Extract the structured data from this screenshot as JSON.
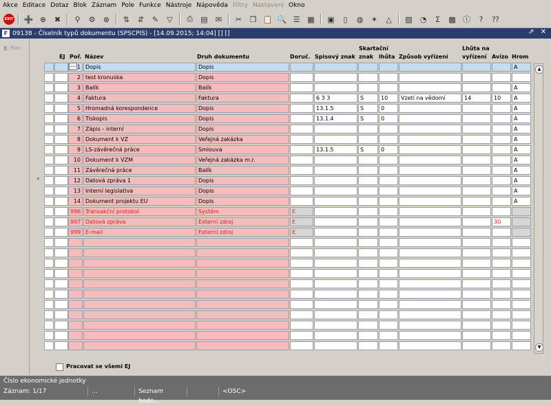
{
  "menu": [
    "Akce",
    "Editace",
    "Dotaz",
    "Blok",
    "Záznam",
    "Pole",
    "Funkce",
    "Nástroje",
    "Nápověda",
    "Filtry",
    "Nastavení",
    "Okno"
  ],
  "menu_disabled": [
    false,
    false,
    false,
    false,
    false,
    false,
    false,
    false,
    false,
    true,
    true,
    false
  ],
  "window": {
    "icon": "F",
    "title": "09138 - Číselník typů dokumentu (SPSCPIS) - [14.09.2015; 14:04]  []  []",
    "controls": "⇗ ✕"
  },
  "leftpane": {
    "nav": "Nav"
  },
  "headers": {
    "ej": "EJ",
    "por": "Poř.",
    "nazev": "Název",
    "druh": "Druh dokumentu",
    "doruc": "Doruč.",
    "spis": "Spisový znak",
    "skart": "Skartační",
    "skart_znak": "znak",
    "skart_lhuta": "lhůta",
    "zpusob": "Způsob vyřízení",
    "lhuta_na": "Lhůta na",
    "lhuta_vyr": "vyřízení",
    "avizo": "Avízo",
    "hrom": "Hrom"
  },
  "rows": [
    {
      "marker": "",
      "ej": "",
      "por": "1",
      "nazev": "Dopis",
      "druh": "Dopis",
      "doruc": "",
      "spis": "",
      "znak": "",
      "lhuta": "",
      "zpusob": "",
      "lvyr": "",
      "avizo": "",
      "hrom": "A",
      "style": "current"
    },
    {
      "marker": "",
      "ej": "",
      "por": "2",
      "nazev": "test kronuska",
      "druh": "Dopis",
      "doruc": "",
      "spis": "",
      "znak": "",
      "lhuta": "",
      "zpusob": "",
      "lvyr": "",
      "avizo": "",
      "hrom": "",
      "style": "normal"
    },
    {
      "marker": "",
      "ej": "",
      "por": "3",
      "nazev": "Balík",
      "druh": "Balík",
      "doruc": "",
      "spis": "",
      "znak": "",
      "lhuta": "",
      "zpusob": "",
      "lvyr": "",
      "avizo": "",
      "hrom": "A",
      "style": "normal"
    },
    {
      "marker": "",
      "ej": "",
      "por": "4",
      "nazev": "Faktura",
      "druh": "Faktura",
      "doruc": "",
      "spis": "6 3 3",
      "znak": "S",
      "lhuta": "10",
      "zpusob": "Vzetí na vědomí",
      "lvyr": "14",
      "avizo": "10",
      "hrom": "A",
      "style": "normal"
    },
    {
      "marker": "",
      "ej": "",
      "por": "5",
      "nazev": "Hromadná korespondence",
      "druh": "Dopis",
      "doruc": "",
      "spis": "13.1.5",
      "znak": "S",
      "lhuta": "0",
      "zpusob": "",
      "lvyr": "",
      "avizo": "",
      "hrom": "A",
      "style": "normal"
    },
    {
      "marker": "",
      "ej": "",
      "por": "6",
      "nazev": "Tiskopis",
      "druh": "Dopis",
      "doruc": "",
      "spis": "13.1.4",
      "znak": "S",
      "lhuta": "0",
      "zpusob": "",
      "lvyr": "",
      "avizo": "",
      "hrom": "A",
      "style": "normal"
    },
    {
      "marker": "",
      "ej": "",
      "por": "7",
      "nazev": "Zápis - interní",
      "druh": "Dopis",
      "doruc": "",
      "spis": "",
      "znak": "",
      "lhuta": "",
      "zpusob": "",
      "lvyr": "",
      "avizo": "",
      "hrom": "A",
      "style": "normal"
    },
    {
      "marker": "",
      "ej": "",
      "por": "8",
      "nazev": "Dokument k VZ",
      "druh": "Veřejná zakázka",
      "doruc": "",
      "spis": "",
      "znak": "",
      "lhuta": "",
      "zpusob": "",
      "lvyr": "",
      "avizo": "",
      "hrom": "A",
      "style": "normal"
    },
    {
      "marker": "",
      "ej": "",
      "por": "9",
      "nazev": "LS-závěrečná práce",
      "druh": "Smlouva",
      "doruc": "",
      "spis": "13.1.5",
      "znak": "S",
      "lhuta": "0",
      "zpusob": "",
      "lvyr": "",
      "avizo": "",
      "hrom": "A",
      "style": "normal"
    },
    {
      "marker": "",
      "ej": "",
      "por": "10",
      "nazev": "Dokument k VZM",
      "druh": "Veřejná zakázka m.r.",
      "doruc": "",
      "spis": "",
      "znak": "",
      "lhuta": "",
      "zpusob": "",
      "lvyr": "",
      "avizo": "",
      "hrom": "A",
      "style": "normal"
    },
    {
      "marker": "",
      "ej": "",
      "por": "11",
      "nazev": "Závěrečná práce",
      "druh": "Balík",
      "doruc": "",
      "spis": "",
      "znak": "",
      "lhuta": "",
      "zpusob": "",
      "lvyr": "",
      "avizo": "",
      "hrom": "A",
      "style": "normal"
    },
    {
      "marker": "*",
      "ej": "",
      "por": "12",
      "nazev": "Datová zpráva 1",
      "druh": "Dopis",
      "doruc": "",
      "spis": "",
      "znak": "",
      "lhuta": "",
      "zpusob": "",
      "lvyr": "",
      "avizo": "",
      "hrom": "A",
      "style": "normal"
    },
    {
      "marker": "",
      "ej": "",
      "por": "13",
      "nazev": "Interní legislativa",
      "druh": "Dopis",
      "doruc": "",
      "spis": "",
      "znak": "",
      "lhuta": "",
      "zpusob": "",
      "lvyr": "",
      "avizo": "",
      "hrom": "A",
      "style": "normal"
    },
    {
      "marker": "",
      "ej": "",
      "por": "14",
      "nazev": "Dokument projektu EU",
      "druh": "Dopis",
      "doruc": "",
      "spis": "",
      "znak": "",
      "lhuta": "",
      "zpusob": "",
      "lvyr": "",
      "avizo": "",
      "hrom": "A",
      "style": "normal"
    },
    {
      "marker": "",
      "ej": "",
      "por": "996",
      "nazev": "Transakční protokol",
      "druh": "Systém",
      "doruc": "E",
      "spis": "",
      "znak": "",
      "lhuta": "",
      "zpusob": "",
      "lvyr": "",
      "avizo": "",
      "hrom": "",
      "style": "system"
    },
    {
      "marker": "",
      "ej": "",
      "por": "997",
      "nazev": "Datová zpráva",
      "druh": "Externí zdroj",
      "doruc": "E",
      "spis": "",
      "znak": "",
      "lhuta": "",
      "zpusob": "",
      "lvyr": "",
      "avizo": "30",
      "hrom": "",
      "style": "system"
    },
    {
      "marker": "",
      "ej": "",
      "por": "999",
      "nazev": "E-mail",
      "druh": "Externí zdroj",
      "doruc": "E",
      "spis": "",
      "znak": "",
      "lhuta": "",
      "zpusob": "",
      "lvyr": "",
      "avizo": "",
      "hrom": "",
      "style": "system"
    }
  ],
  "empty_rows": 11,
  "checkbox": {
    "label": "Pracovat se všemi EJ"
  },
  "status": {
    "hint": "Číslo ekonomické jednotky",
    "record": "Záznam: 1/17",
    "s2": "...",
    "s3": "Seznam hodn...",
    "s4": "<OSC>"
  },
  "colors": {
    "pink": "#f4bcbc",
    "current": "#c8dcf0",
    "title": "#2a3e6e",
    "status": "#6c6c6c",
    "system_text": "#e02020"
  }
}
